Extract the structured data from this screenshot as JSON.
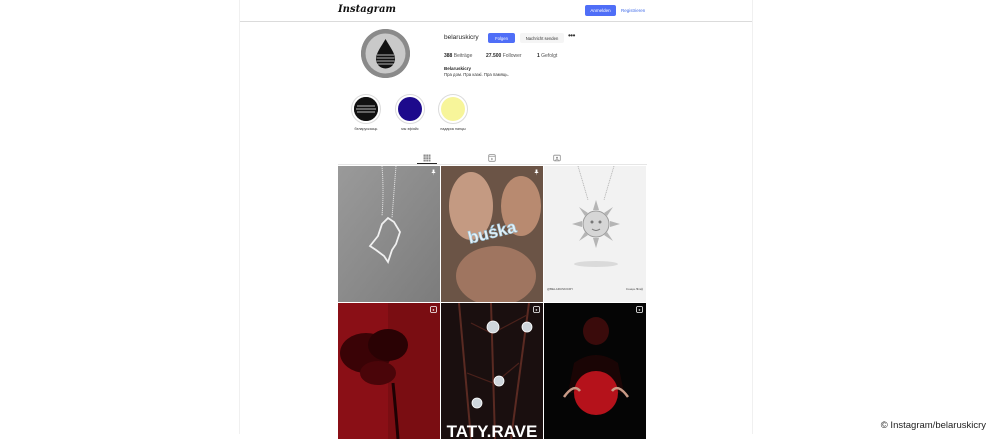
{
  "header": {
    "logo": "Instagram",
    "login_label": "Anmelden",
    "register_label": "Registrieren"
  },
  "profile": {
    "username": "belaruskicry",
    "follow_label": "Folgen",
    "message_label": "Nachricht senden",
    "more_label": "•••",
    "posts_count": "388",
    "posts_label": "Beiträge",
    "followers_count": "27.500",
    "followers_label": "Follower",
    "following_count": "1",
    "following_label": "Gefolgt",
    "bio_name": "Belaruskicry",
    "bio_text": "Пра дом. Пра казкі. Пра памяць."
  },
  "highlights": [
    {
      "label": "беларускасць",
      "color": "#111111"
    },
    {
      "label": "мы эфіяйс",
      "color": "#1d0a8c"
    },
    {
      "label": "падарок панцы",
      "color": "#f7f59a"
    }
  ],
  "tabs": [
    {
      "name": "posts",
      "icon": "grid-icon",
      "active": true
    },
    {
      "name": "reels",
      "icon": "reels-icon",
      "active": false
    },
    {
      "name": "tagged",
      "icon": "tagged-icon",
      "active": false
    }
  ],
  "posts": [
    {
      "name": "pendant-map-necklace",
      "pinned": true
    },
    {
      "name": "buska-necklace",
      "pinned": true,
      "text": "buśka"
    },
    {
      "name": "sun-pendant",
      "pinned": false,
      "caption_left": "@BELARUSKICRY",
      "caption_right": "Сонца Ліпаў"
    },
    {
      "name": "red-flower-post",
      "reel": true
    },
    {
      "name": "taty-rave-post",
      "reel": true,
      "text": "TATY.RAVE"
    },
    {
      "name": "red-circle-portrait",
      "reel": true
    }
  ],
  "credit": "© Instagram/belaruskicry"
}
